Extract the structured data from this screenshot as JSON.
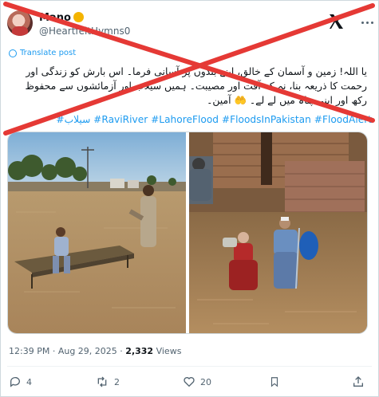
{
  "user": {
    "display_name": "Mano",
    "handle": "@HeartfeltHymns0"
  },
  "translate_label": "Translate post",
  "text_lines": [
    "یا اللہ! زمین و آسمان کے خالق، اپنے بندوں پر آسانی فرما۔ اس بارش کو زندگی اور",
    "رحمت کا ذریعہ بنا، نہ کہ آفت اور مصیبت۔ ہمیں سیلاب اور آزمائشوں سے محفوظ",
    "رکھ اور اپنی پناہ میں لے لے۔ 🤲 آمین۔"
  ],
  "hashtags": "#سیلاب #RaviRiver #LahoreFlood #FloodsInPakistan #FloodAlert",
  "meta": {
    "time": "12:39 PM",
    "separator": "·",
    "date": "Aug 29, 2025",
    "views_count": "2,332",
    "views_label": "Views"
  },
  "actions": {
    "replies": "4",
    "reposts": "2",
    "likes": "20"
  },
  "colors": {
    "accent": "#1d9bf0",
    "cross": "#e53935",
    "muted": "#536471"
  }
}
